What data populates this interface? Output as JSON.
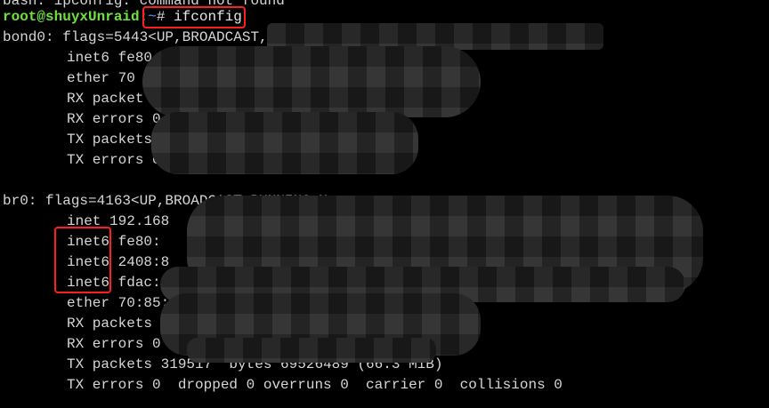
{
  "terminal": {
    "top_line": "bash: ipconfig: command not found",
    "prompt_user": "root@shuyxUnraid",
    "prompt_sep": ":",
    "prompt_path": "~",
    "prompt_symbol": "#",
    "command": "ifconfig",
    "bond0": {
      "header": "bond0: flags=5443<UP,BROADCAST,RUN",
      "lines": [
        "inet6 fe80",
        "ether 70",
        "RX packet",
        "RX errors 0",
        "TX packets 35",
        "TX errors 0  dropp"
      ]
    },
    "br0": {
      "header": "br0: flags=4163<UP,BROADCAST,RUNNING,M",
      "lines": [
        "inet 192.168",
        "inet6 fe80:",
        "inet6 2408:8",
        "inet6 fdac:a",
        "ether 70:85:c2",
        "RX packets 3563",
        "RX errors 0  dro",
        "TX packets 319517  bytes 69526489 (66.3 MiB)",
        "TX errors 0  dropped 0 overruns 0  carrier 0  collisions 0"
      ]
    }
  },
  "annotations": {
    "highlight_color": "#ff1e1e"
  }
}
